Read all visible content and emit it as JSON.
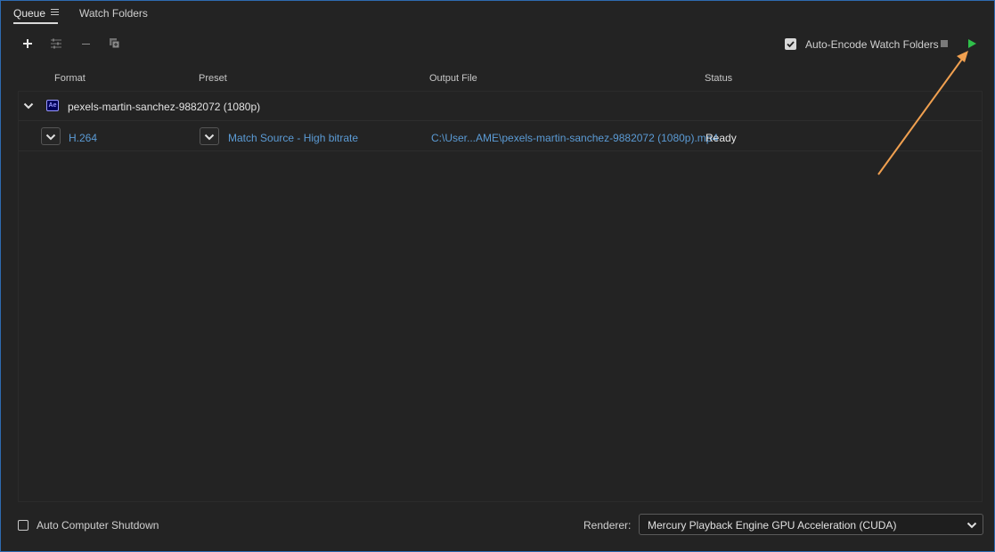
{
  "tabs": {
    "queue": "Queue",
    "watch_folders": "Watch Folders"
  },
  "toolbar": {
    "auto_encode_label": "Auto-Encode Watch Folders",
    "auto_encode_checked": true
  },
  "columns": {
    "format": "Format",
    "preset": "Preset",
    "output": "Output File",
    "status": "Status"
  },
  "queue": {
    "group": {
      "app_badge": "Ae",
      "name": "pexels-martin-sanchez-9882072 (1080p)"
    },
    "item": {
      "format": "H.264",
      "preset": "Match Source - High bitrate",
      "output": "C:\\User...AME\\pexels-martin-sanchez-9882072 (1080p).mp4",
      "status": "Ready"
    }
  },
  "footer": {
    "shutdown_label": "Auto Computer Shutdown",
    "shutdown_checked": false,
    "renderer_label": "Renderer:",
    "renderer_value": "Mercury Playback Engine GPU Acceleration (CUDA)"
  },
  "colors": {
    "link": "#5b9bd5",
    "play": "#2fbf4a",
    "annotation": "#f0a050",
    "frame": "#2e6bb0"
  }
}
